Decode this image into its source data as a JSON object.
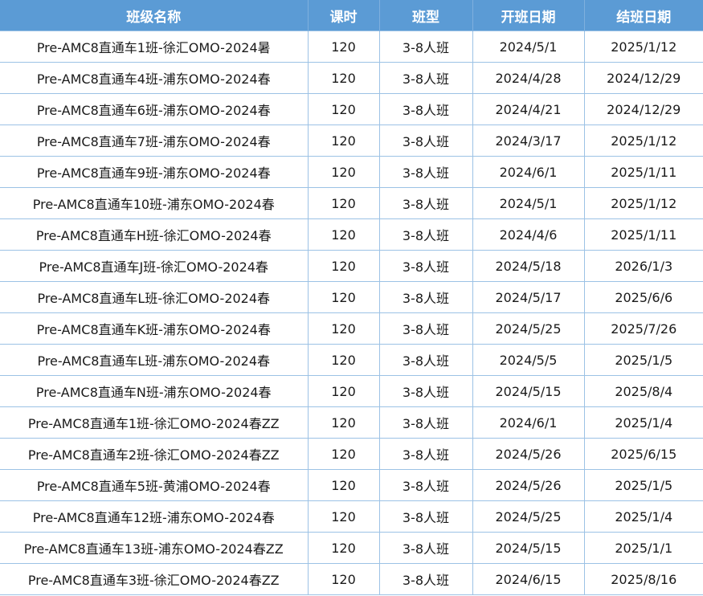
{
  "table": {
    "headers": [
      "班级名称",
      "课时",
      "班型",
      "开班日期",
      "结班日期"
    ],
    "rows": [
      [
        "Pre-AMC8直通车1班-徐汇OMO-2024暑",
        "120",
        "3-8人班",
        "2024/5/1",
        "2025/1/12"
      ],
      [
        "Pre-AMC8直通车4班-浦东OMO-2024春",
        "120",
        "3-8人班",
        "2024/4/28",
        "2024/12/29"
      ],
      [
        "Pre-AMC8直通车6班-浦东OMO-2024春",
        "120",
        "3-8人班",
        "2024/4/21",
        "2024/12/29"
      ],
      [
        "Pre-AMC8直通车7班-浦东OMO-2024春",
        "120",
        "3-8人班",
        "2024/3/17",
        "2025/1/12"
      ],
      [
        "Pre-AMC8直通车9班-浦东OMO-2024春",
        "120",
        "3-8人班",
        "2024/6/1",
        "2025/1/11"
      ],
      [
        "Pre-AMC8直通车10班-浦东OMO-2024春",
        "120",
        "3-8人班",
        "2024/5/1",
        "2025/1/12"
      ],
      [
        "Pre-AMC8直通车H班-徐汇OMO-2024春",
        "120",
        "3-8人班",
        "2024/4/6",
        "2025/1/11"
      ],
      [
        "Pre-AMC8直通车J班-徐汇OMO-2024春",
        "120",
        "3-8人班",
        "2024/5/18",
        "2026/1/3"
      ],
      [
        "Pre-AMC8直通车L班-徐汇OMO-2024春",
        "120",
        "3-8人班",
        "2024/5/17",
        "2025/6/6"
      ],
      [
        "Pre-AMC8直通车K班-浦东OMO-2024春",
        "120",
        "3-8人班",
        "2024/5/25",
        "2025/7/26"
      ],
      [
        "Pre-AMC8直通车L班-浦东OMO-2024春",
        "120",
        "3-8人班",
        "2024/5/5",
        "2025/1/5"
      ],
      [
        "Pre-AMC8直通车N班-浦东OMO-2024春",
        "120",
        "3-8人班",
        "2024/5/15",
        "2025/8/4"
      ],
      [
        "Pre-AMC8直通车1班-徐汇OMO-2024春ZZ",
        "120",
        "3-8人班",
        "2024/6/1",
        "2025/1/4"
      ],
      [
        "Pre-AMC8直通车2班-徐汇OMO-2024春ZZ",
        "120",
        "3-8人班",
        "2024/5/26",
        "2025/6/15"
      ],
      [
        "Pre-AMC8直通车5班-黄浦OMO-2024春",
        "120",
        "3-8人班",
        "2024/5/26",
        "2025/1/5"
      ],
      [
        "Pre-AMC8直通车12班-浦东OMO-2024春",
        "120",
        "3-8人班",
        "2024/5/25",
        "2025/1/4"
      ],
      [
        "Pre-AMC8直通车13班-浦东OMO-2024春ZZ",
        "120",
        "3-8人班",
        "2024/5/15",
        "2025/1/1"
      ],
      [
        "Pre-AMC8直通车3班-徐汇OMO-2024春ZZ",
        "120",
        "3-8人班",
        "2024/6/15",
        "2025/8/16"
      ]
    ]
  },
  "colors": {
    "header_bg": "#5b9bd5",
    "header_text": "#ffffff",
    "grid_line": "#9cc2e5"
  }
}
